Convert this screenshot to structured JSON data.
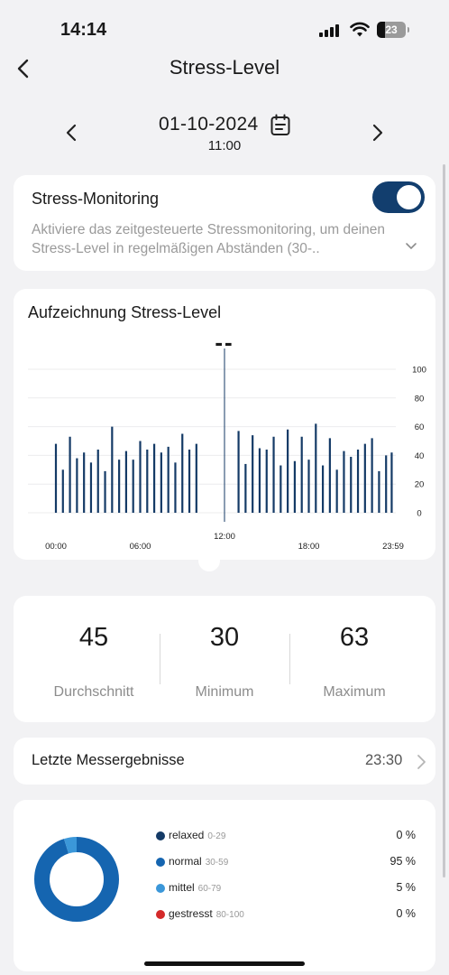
{
  "status": {
    "time": "14:14",
    "battery": "23"
  },
  "nav": {
    "title": "Stress-Level"
  },
  "date": {
    "day": "01-10-2024",
    "time": "11:00"
  },
  "monitoring": {
    "title": "Stress-Monitoring",
    "enabled": true,
    "description": "Aktiviere das zeitgesteuerte Stressmonitoring, um deinen Stress-Level in regelmäßigen Abständen (30-.."
  },
  "chart_title": "Aufzeichnung Stress-Level",
  "chart_current": "--",
  "chart_data": {
    "type": "bar",
    "title": "",
    "x_tick_labels": [
      "00:00",
      "06:00",
      "12:00",
      "18:00",
      "23:59"
    ],
    "y_tick_labels": [
      "100",
      "80",
      "60",
      "40",
      "20",
      "0"
    ],
    "ylim": [
      0,
      100
    ],
    "x_range_hours": [
      0,
      24
    ],
    "selected_hour": 12,
    "bar_color": "#143a66",
    "points": [
      {
        "h": 0.0,
        "v": 48
      },
      {
        "h": 0.5,
        "v": 30
      },
      {
        "h": 1.0,
        "v": 53
      },
      {
        "h": 1.5,
        "v": 38
      },
      {
        "h": 2.0,
        "v": 42
      },
      {
        "h": 2.5,
        "v": 35
      },
      {
        "h": 3.0,
        "v": 44
      },
      {
        "h": 3.5,
        "v": 29
      },
      {
        "h": 4.0,
        "v": 60
      },
      {
        "h": 4.5,
        "v": 37
      },
      {
        "h": 5.0,
        "v": 43
      },
      {
        "h": 5.5,
        "v": 37
      },
      {
        "h": 6.0,
        "v": 50
      },
      {
        "h": 6.5,
        "v": 44
      },
      {
        "h": 7.0,
        "v": 48
      },
      {
        "h": 7.5,
        "v": 42
      },
      {
        "h": 8.0,
        "v": 46
      },
      {
        "h": 8.5,
        "v": 35
      },
      {
        "h": 9.0,
        "v": 55
      },
      {
        "h": 9.5,
        "v": 44
      },
      {
        "h": 10.0,
        "v": 48
      },
      {
        "h": 13.0,
        "v": 57
      },
      {
        "h": 13.5,
        "v": 34
      },
      {
        "h": 14.0,
        "v": 54
      },
      {
        "h": 14.5,
        "v": 45
      },
      {
        "h": 15.0,
        "v": 44
      },
      {
        "h": 15.5,
        "v": 53
      },
      {
        "h": 16.0,
        "v": 33
      },
      {
        "h": 16.5,
        "v": 58
      },
      {
        "h": 17.0,
        "v": 36
      },
      {
        "h": 17.5,
        "v": 53
      },
      {
        "h": 18.0,
        "v": 37
      },
      {
        "h": 18.5,
        "v": 62
      },
      {
        "h": 19.0,
        "v": 33
      },
      {
        "h": 19.5,
        "v": 52
      },
      {
        "h": 20.0,
        "v": 30
      },
      {
        "h": 20.5,
        "v": 43
      },
      {
        "h": 21.0,
        "v": 39
      },
      {
        "h": 21.5,
        "v": 44
      },
      {
        "h": 22.0,
        "v": 48
      },
      {
        "h": 22.5,
        "v": 52
      },
      {
        "h": 23.0,
        "v": 29
      },
      {
        "h": 23.5,
        "v": 40
      },
      {
        "h": 23.9,
        "v": 42
      }
    ]
  },
  "stats": {
    "avg": {
      "value": "45",
      "label": "Durchschnitt"
    },
    "min": {
      "value": "30",
      "label": "Minimum"
    },
    "max": {
      "value": "63",
      "label": "Maximum"
    }
  },
  "last": {
    "label": "Letzte Messergebnisse",
    "time": "23:30"
  },
  "legend": [
    {
      "name": "relaxed",
      "range": "0-29",
      "pct": "0 %",
      "color": "#143a66",
      "share": 0
    },
    {
      "name": "normal",
      "range": "30-59",
      "pct": "95 %",
      "color": "#1565b0",
      "share": 95
    },
    {
      "name": "mittel",
      "range": "60-79",
      "pct": "5 %",
      "color": "#3b97d9",
      "share": 5
    },
    {
      "name": "gestresst",
      "range": "80-100",
      "pct": "0 %",
      "color": "#d42a2a",
      "share": 0
    }
  ]
}
